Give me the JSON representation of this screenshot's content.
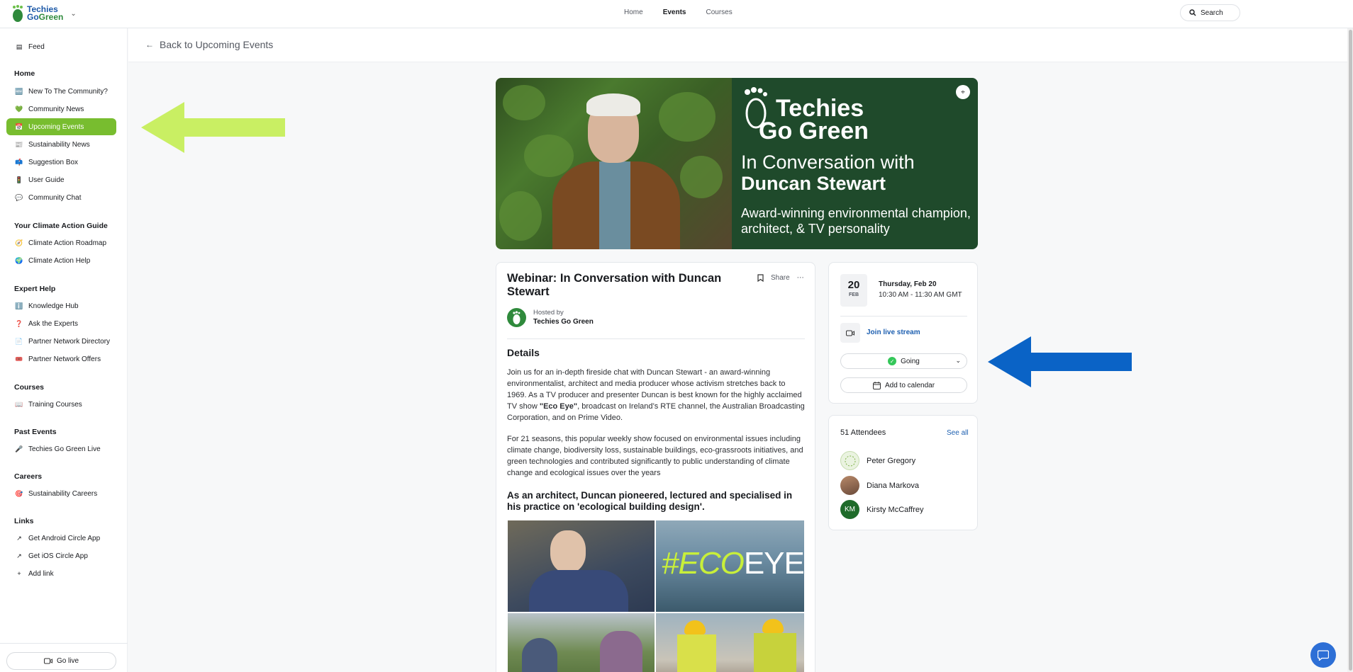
{
  "logo": {
    "line1": "Techies",
    "line2a": "Go",
    "line2b": "Green"
  },
  "topnav": {
    "home": "Home",
    "events": "Events",
    "courses": "Courses",
    "search": "Search"
  },
  "sidebar": {
    "feed": "Feed",
    "sections": [
      {
        "heading": "Home",
        "items": [
          "New To The Community?",
          "Community News",
          "Upcoming Events",
          "Sustainability News",
          "Suggestion Box",
          "User Guide",
          "Community Chat"
        ]
      },
      {
        "heading": "Your Climate Action Guide",
        "items": [
          "Climate Action Roadmap",
          "Climate Action Help"
        ]
      },
      {
        "heading": "Expert Help",
        "items": [
          "Knowledge Hub",
          "Ask the Experts",
          "Partner Network Directory",
          "Partner Network Offers"
        ]
      },
      {
        "heading": "Courses",
        "items": [
          "Training Courses"
        ]
      },
      {
        "heading": "Past Events",
        "items": [
          "Techies Go Green Live"
        ]
      },
      {
        "heading": "Careers",
        "items": [
          "Sustainability Careers"
        ]
      },
      {
        "heading": "Links",
        "items": [
          "Get Android Circle App",
          "Get iOS Circle App",
          "Add link"
        ]
      }
    ],
    "go_live": "Go live"
  },
  "back_link": "Back to Upcoming Events",
  "banner": {
    "logo1": "Techies",
    "logo2": "Go Green",
    "line1": "In Conversation with",
    "line2": "Duncan Stewart",
    "line3": "Award-winning environmental champion, architect, & TV personality"
  },
  "event": {
    "title": "Webinar: In Conversation with Duncan Stewart",
    "share": "Share",
    "hosted_by": "Hosted by",
    "host": "Techies Go Green",
    "details_heading": "Details",
    "para1_a": "Join us for an in-depth fireside chat with Duncan Stewart - an award-winning environmentalist, architect and media producer whose activism stretches back to 1969. As a TV producer and presenter Duncan is best known for the highly acclaimed TV show ",
    "para1_bold": "\"Eco Eye\"",
    "para1_b": ", broadcast on Ireland’s RTE channel, the Australian Broadcasting Corporation, and on Prime Video.",
    "para2": "For 21 seasons, this popular weekly show focused on environmental issues including climate change, biodiversity loss, sustainable buildings, eco-grassroots initiatives, and green technologies and contributed significantly to public understanding of climate change and ecological issues over the years",
    "subheading": "As an architect, Duncan pioneered, lectured and specialised in his practice on 'ecological building design'.",
    "collage_text_a": "#ECO",
    "collage_text_b": "EYE"
  },
  "schedule": {
    "day": "20",
    "month": "FEB",
    "date_line": "Thursday, Feb 20",
    "time_line": "10:30 AM - 11:30 AM GMT",
    "live_stream": "Join live stream",
    "rsvp": "Going",
    "add_calendar": "Add to calendar"
  },
  "attendees": {
    "heading": "51 Attendees",
    "see_all": "See all",
    "list": [
      {
        "name": "Peter Gregory",
        "initials": ""
      },
      {
        "name": "Diana Markova",
        "initials": ""
      },
      {
        "name": "Kirsty McCaffrey",
        "initials": "KM"
      }
    ]
  },
  "colors": {
    "accent_green": "#78bd2f",
    "link_blue": "#1d5fb0",
    "banner_green": "#1f4a2b",
    "arrow_green": "#c9ef63",
    "arrow_blue": "#0a63c6"
  }
}
